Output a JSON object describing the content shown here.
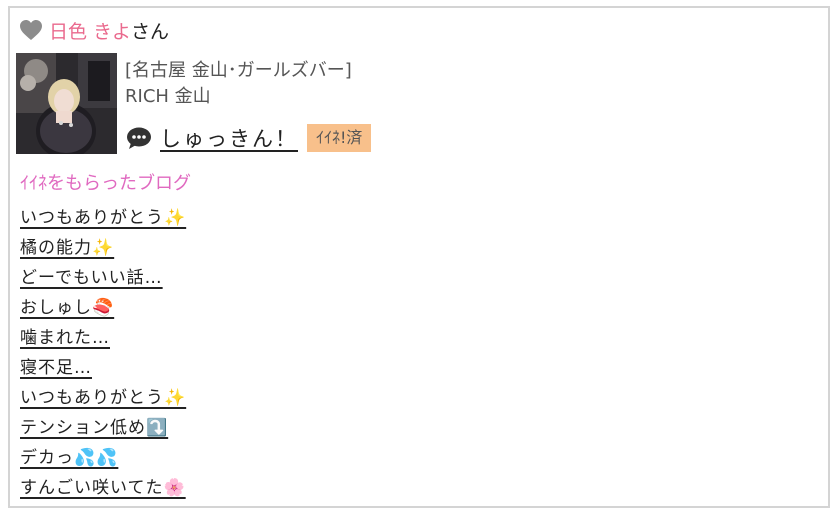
{
  "header": {
    "icon": "heart-icon",
    "user_name": "日色 きよ",
    "honorific": "さん",
    "accent_color": "#ea6a8e"
  },
  "shop": {
    "area": "[名古屋 金山･ガールズバー]",
    "name": "RICH 金山"
  },
  "post": {
    "icon": "speech-bubble-icon",
    "title": "しゅっきん！",
    "badge": "ｲｲﾈ!済",
    "badge_color": "#f8c08b"
  },
  "blog": {
    "heading": "ｲｲﾈをもらったブログ",
    "heading_color": "#e069c0",
    "items": [
      {
        "title": "いつもありがとう✨"
      },
      {
        "title": "橘の能力✨"
      },
      {
        "title": "どーでもいい話…"
      },
      {
        "title": "おしゅし🍣"
      },
      {
        "title": "噛まれた…"
      },
      {
        "title": "寝不足…"
      },
      {
        "title": "いつもありがとう✨"
      },
      {
        "title": "テンション低め⤵️"
      },
      {
        "title": "デカっ💦💦"
      },
      {
        "title": "すんごい咲いてた🌸"
      }
    ]
  }
}
